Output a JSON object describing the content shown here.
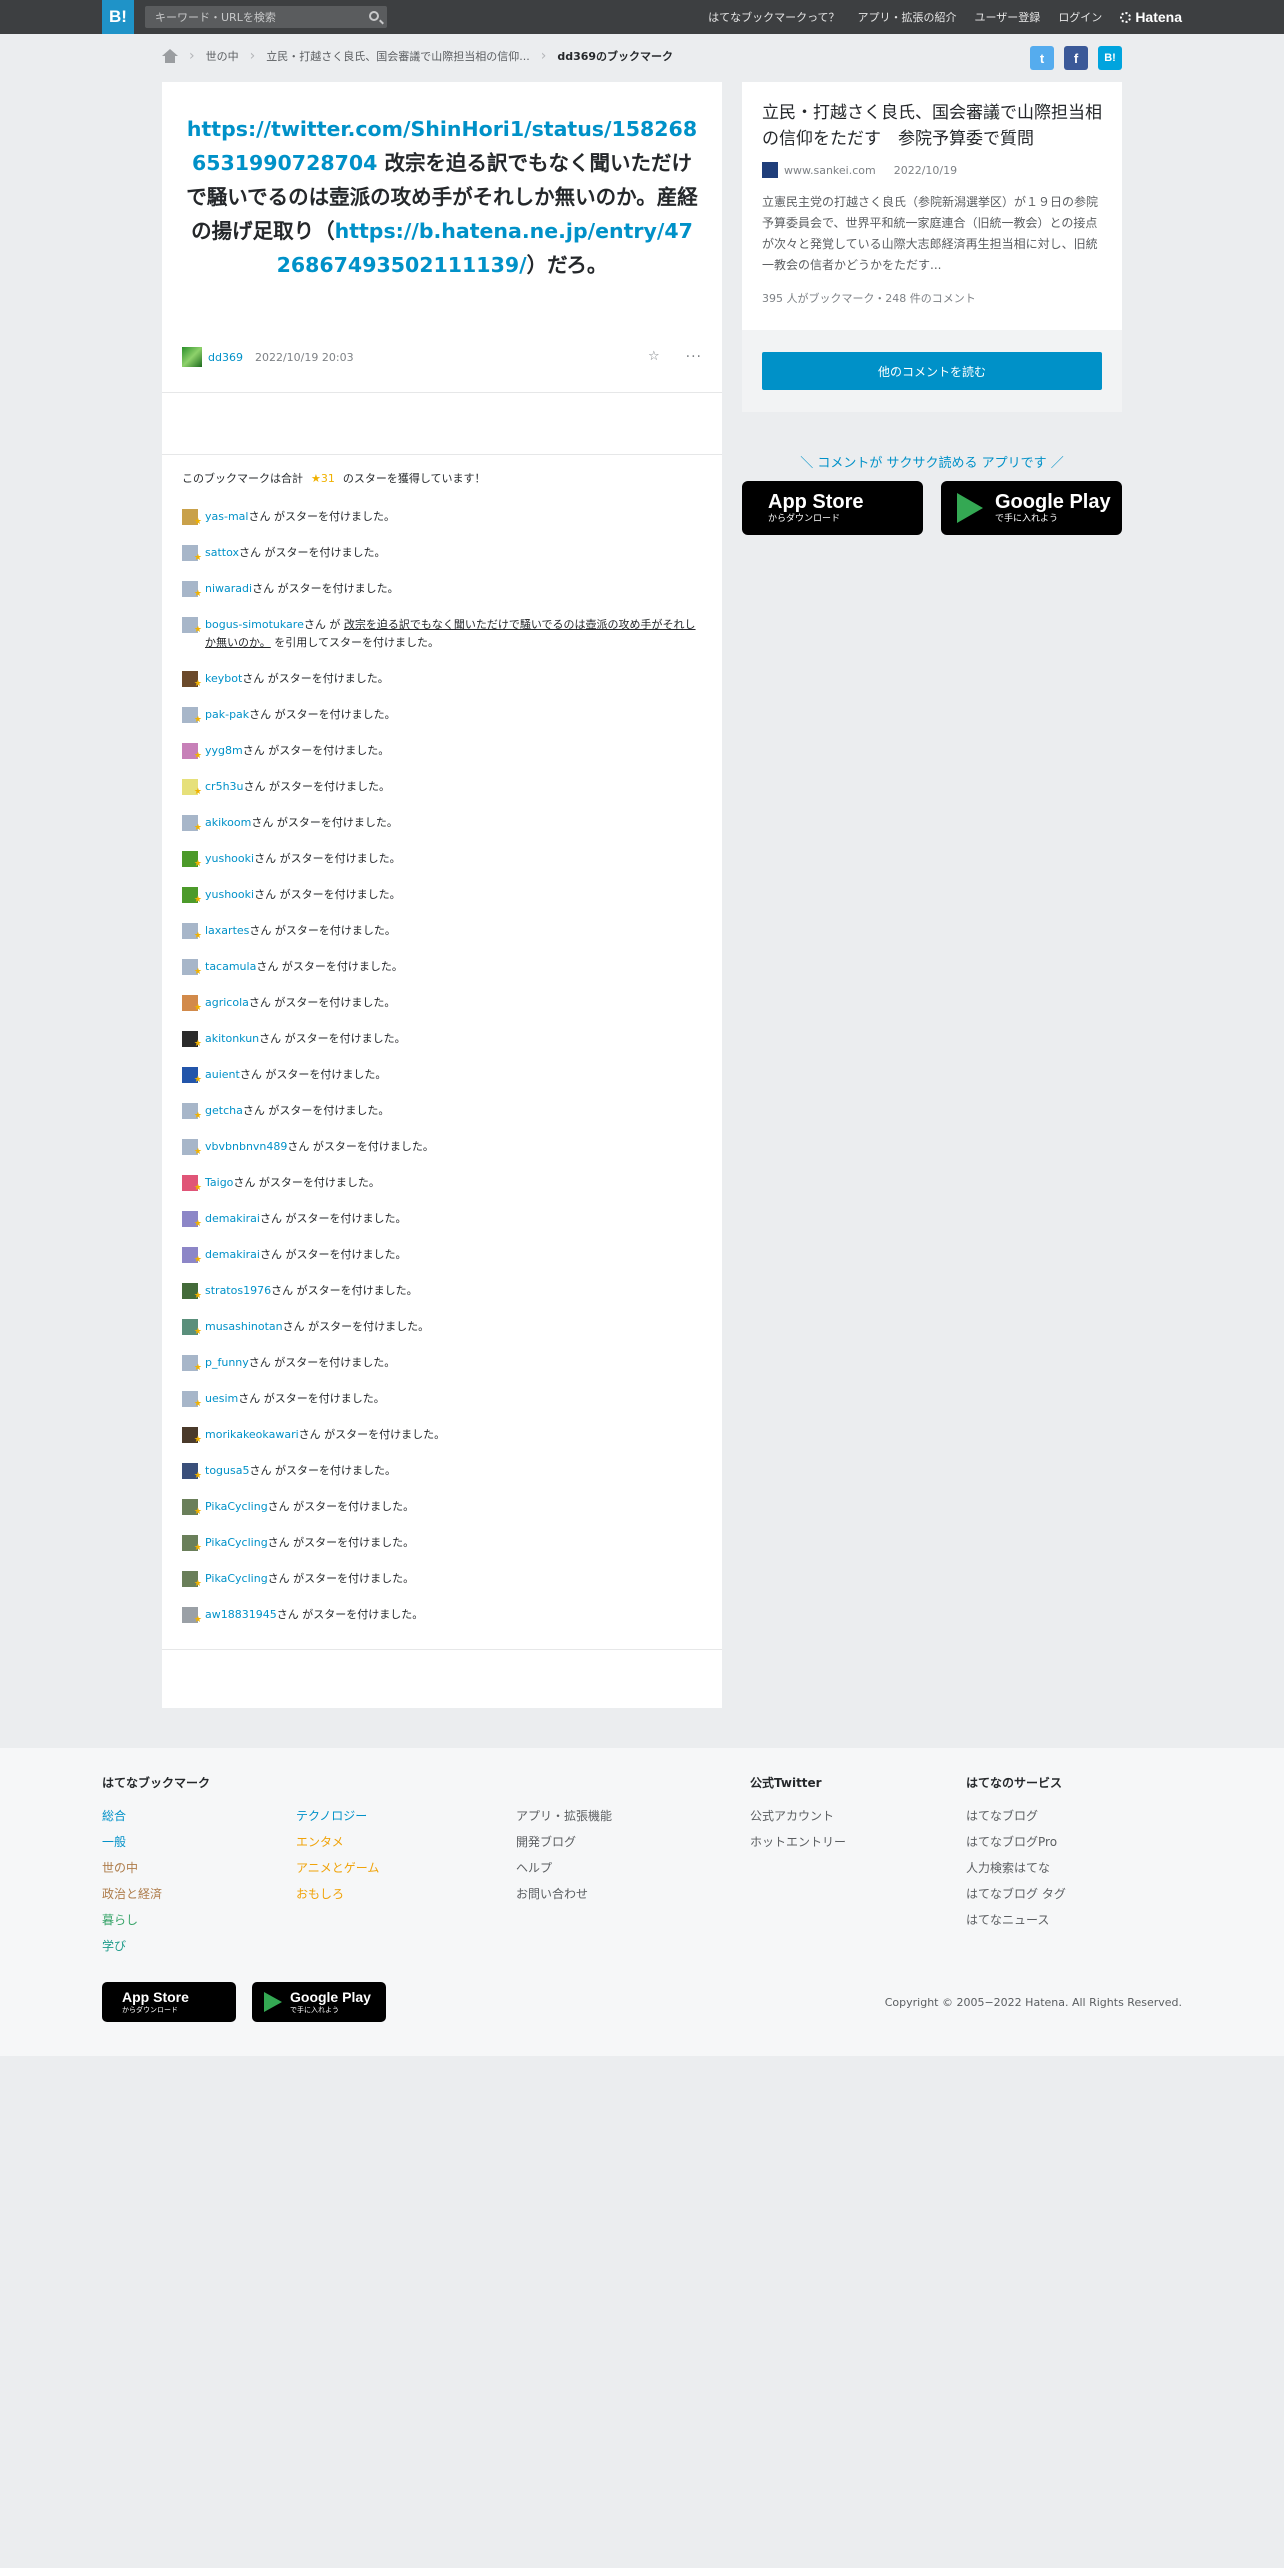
{
  "header": {
    "logo": "B!",
    "search_placeholder": "キーワード・URLを検索",
    "nav": [
      "はてなブックマークって？",
      "アプリ・拡張の紹介",
      "ユーザー登録",
      "ログイン"
    ],
    "brand": "Hatena"
  },
  "breadcrumb": {
    "items": [
      "世の中",
      "立民・打越さく良氏、国会審議で山際担当相の信仰...",
      "dd369のブックマーク"
    ]
  },
  "share": {
    "twitter": "t",
    "facebook": "f",
    "hatena": "B!"
  },
  "comment": {
    "link1": "https://twitter.com/ShinHori1/status/1582686531990728704",
    "text1": " 改宗を迫る訳でもなく聞いただけで騒いでるのは壺派の攻め手がそれしか無いのか。産経の揚げ足取り（",
    "link2": "https://b.hatena.ne.jp/entry/4726867493502111139/",
    "text2": "）だろ。",
    "user": "dd369",
    "datetime": "2022/10/19 20:03",
    "star_add": "☆",
    "more": "···"
  },
  "stars": {
    "summary_prefix": "このブックマークは合計",
    "summary_count": "★31",
    "summary_suffix": "のスターを獲得しています！",
    "suffix": "さん がスターを付けました。",
    "quote_mid": "さん が",
    "quote_text": "改宗を迫る訳でもなく聞いただけで騒いでるのは壺派の攻め手がそれしか無いのか。",
    "quote_suffix": "を引用してスターを付けました。",
    "users": [
      {
        "name": "yas-mal"
      },
      {
        "name": "sattox"
      },
      {
        "name": "niwaradi"
      },
      {
        "name": "bogus-simotukare",
        "quote": true
      },
      {
        "name": "keybot"
      },
      {
        "name": "pak-pak"
      },
      {
        "name": "yyg8m"
      },
      {
        "name": "cr5h3u"
      },
      {
        "name": "akikoom"
      },
      {
        "name": "yushooki"
      },
      {
        "name": "yushooki"
      },
      {
        "name": "laxartes"
      },
      {
        "name": "tacamula"
      },
      {
        "name": "agricola"
      },
      {
        "name": "akitonkun"
      },
      {
        "name": "auient"
      },
      {
        "name": "getcha"
      },
      {
        "name": "vbvbnbnvn489"
      },
      {
        "name": "Taigo"
      },
      {
        "name": "demakirai"
      },
      {
        "name": "demakirai"
      },
      {
        "name": "stratos1976"
      },
      {
        "name": "musashinotan"
      },
      {
        "name": "p_funny"
      },
      {
        "name": "uesim"
      },
      {
        "name": "morikakeokawari"
      },
      {
        "name": "togusa5"
      },
      {
        "name": "PikaCycling"
      },
      {
        "name": "PikaCycling"
      },
      {
        "name": "PikaCycling"
      },
      {
        "name": "aw18831945"
      }
    ]
  },
  "entry": {
    "title": "立民・打越さく良氏、国会審議で山際担当相の信仰をただす　参院予算委で質問",
    "site": "www.sankei.com",
    "date": "2022/10/19",
    "description": "立憲民主党の打越さく良氏（参院新潟選挙区）が１９日の参院予算委員会で、世界平和統一家庭連合（旧統一教会）との接点が次々と発覚している山際大志郎経済再生担当相に対し、旧統一教会の信者かどうかをただす...",
    "count": "395 人がブックマーク・248 件のコメント",
    "button": "他のコメントを読む"
  },
  "app_promo": {
    "text": "＼ コメントが サクサク読める アプリです ／",
    "appstore_small": "からダウンロード",
    "appstore_big": "App Store",
    "googleplay_big": "Google Play",
    "googleplay_small": "で手に入れよう"
  },
  "footer": {
    "col1_title": "はてなブックマーク",
    "col1a": [
      "総合",
      "一般",
      "世の中",
      "政治と経済",
      "暮らし",
      "学び"
    ],
    "col1b": [
      "テクノロジー",
      "エンタメ",
      "アニメとゲーム",
      "おもしろ"
    ],
    "col2": [
      "アプリ・拡張機能",
      "開発ブログ",
      "ヘルプ",
      "お問い合わせ"
    ],
    "col3_title": "公式Twitter",
    "col3": [
      "公式アカウント",
      "ホットエントリー"
    ],
    "col4_title": "はてなのサービス",
    "col4": [
      "はてなブログ",
      "はてなブログPro",
      "人力検索はてな",
      "はてなブログ タグ",
      "はてなニュース"
    ],
    "copyright": "Copyright © 2005−2022 Hatena. All Rights Reserved."
  }
}
